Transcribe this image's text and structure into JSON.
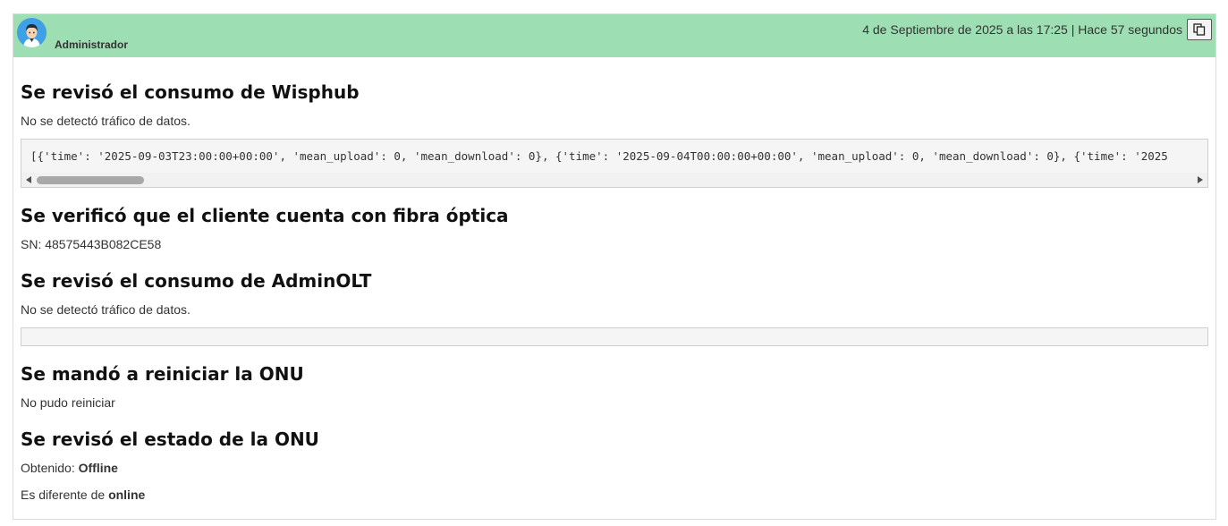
{
  "comment": {
    "author": "Administrador",
    "timestamp": "4 de Septiembre de 2025 a las 17:25 | Hace 57 segundos",
    "copy_icon": "copy-icon",
    "header_color": "#9ddfb2"
  },
  "sections": {
    "wisphub": {
      "title": "Se revisó el consumo de Wisphub",
      "text": "No se detectó tráfico de datos.",
      "code": "[{'time': '2025-09-03T23:00:00+00:00', 'mean_upload': 0, 'mean_download': 0}, {'time': '2025-09-04T00:00:00+00:00', 'mean_upload': 0, 'mean_download': 0}, {'time': '2025"
    },
    "fibra": {
      "title": "Se verificó que el cliente cuenta con fibra óptica",
      "text": "SN: 48575443B082CE58"
    },
    "adminolt": {
      "title": "Se revisó el consumo de AdminOLT",
      "text": "No se detectó tráfico de datos."
    },
    "reinicio": {
      "title": "Se mandó a reiniciar la ONU",
      "text": "No pudo reiniciar"
    },
    "estado": {
      "title": "Se revisó el estado de la ONU",
      "obtained_label": "Obtenido:",
      "obtained_value": "Offline",
      "diff_label": "Es diferente de",
      "diff_value": "online"
    }
  }
}
